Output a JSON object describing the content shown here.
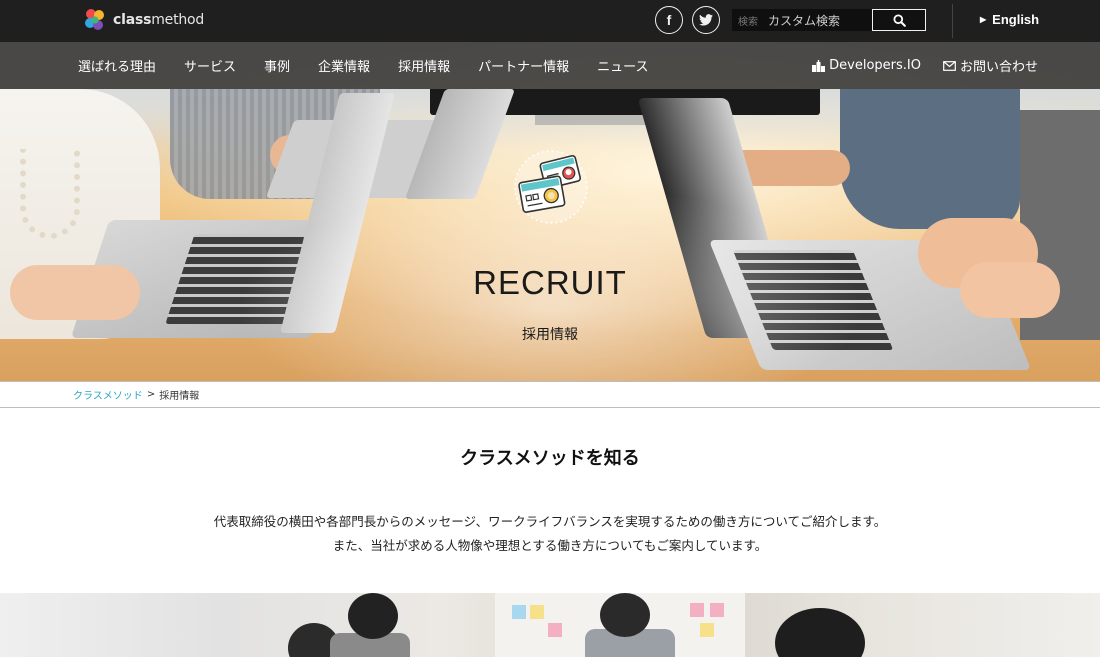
{
  "header": {
    "logo_text_bold": "class",
    "logo_text_light": "method",
    "social": {
      "facebook_glyph": "f",
      "twitter_glyph": "t"
    },
    "search": {
      "label": "検索",
      "placeholder": "カスタム検索"
    },
    "language": "English"
  },
  "nav": {
    "items": [
      "選ばれる理由",
      "サービス",
      "事例",
      "企業情報",
      "採用情報",
      "パートナー情報",
      "ニュース"
    ],
    "developers": "Developers.IO",
    "contact": "お問い合わせ"
  },
  "hero": {
    "title": "RECRUIT",
    "subtitle": "採用情報",
    "icon": "id-cards-icon"
  },
  "breadcrumb": {
    "home": "クラスメソッド",
    "separator": ">",
    "current": "採用情報"
  },
  "intro": {
    "title": "クラスメソッドを知る",
    "line1": "代表取締役の横田や各部門長からのメッセージ、ワークライフバランスを実現するための働き方についてご紹介します。",
    "line2": "また、当社が求める人物像や理想とする働き方についてもご案内しています。"
  },
  "colors": {
    "topbar": "#1f1f1f",
    "nav": "#282828",
    "link": "#2aa4c7"
  }
}
